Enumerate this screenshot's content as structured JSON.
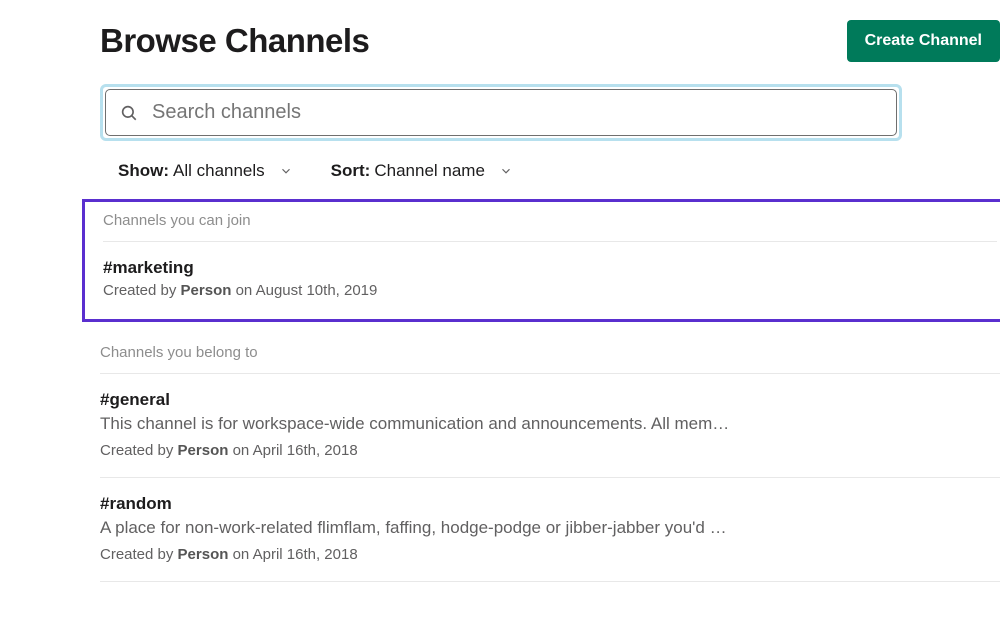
{
  "header": {
    "title": "Browse Channels",
    "create_button": "Create Channel"
  },
  "search": {
    "placeholder": "Search channels"
  },
  "filters": {
    "show_label": "Show:",
    "show_value": "All channels",
    "sort_label": "Sort:",
    "sort_value": "Channel name"
  },
  "sections": {
    "can_join_header": "Channels you can join",
    "belong_header": "Channels you belong to"
  },
  "channels_can_join": [
    {
      "name": "#marketing",
      "created_prefix": "Created by ",
      "created_person": "Person",
      "created_suffix": " on August 10th, 2019"
    }
  ],
  "channels_belong": [
    {
      "name": "#general",
      "desc": "This channel is for workspace-wide communication and announcements. All mem…",
      "created_prefix": "Created by ",
      "created_person": "Person",
      "created_suffix": " on April 16th, 2018"
    },
    {
      "name": "#random",
      "desc": "A place for non-work-related flimflam, faffing, hodge-podge or jibber-jabber you'd …",
      "created_prefix": "Created by ",
      "created_person": "Person",
      "created_suffix": " on April 16th, 2018"
    }
  ]
}
